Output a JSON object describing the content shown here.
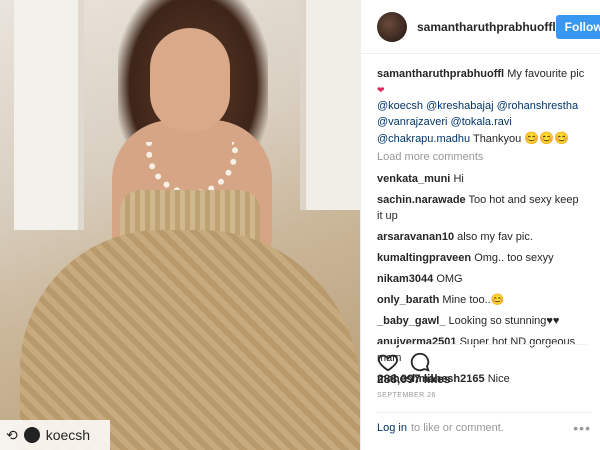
{
  "post": {
    "username": "samantharuthprabhuoffl",
    "follow_label": "Follow",
    "caption_text": "My favourite pic",
    "caption_heart": "❤",
    "mentions_line1": [
      "@koecsh",
      "@kreshabajaj",
      "@rohanshrestha"
    ],
    "mentions_line2": [
      "@vanrajzaveri",
      "@tokala.ravi"
    ],
    "mentions_line3": [
      "@chakrapu.madhu"
    ],
    "thanks_text": "Thankyou",
    "thanks_emoji": "😊😊😊",
    "load_more": "Load more comments",
    "comments": [
      {
        "user": "venkata_muni",
        "text": "Hi"
      },
      {
        "user": "sachin.narawade",
        "text": "Too hot and sexy keep it up"
      },
      {
        "user": "arsaravanan10",
        "text": "also my fav pic."
      },
      {
        "user": "kumaltingpraveen",
        "text": "Omg.. too sexyy"
      },
      {
        "user": "nikam3044",
        "text": "OMG"
      },
      {
        "user": "only_barath",
        "text": "Mine too..😊"
      },
      {
        "user": "_baby_gawl_",
        "text": "Looking so stunning♥♥"
      },
      {
        "user": "anujverma2501",
        "text": "Super hot ND gorgeous mam"
      },
      {
        "user": "maheshmahesh2165",
        "text": "Nice"
      }
    ],
    "likes": "288,097 likes",
    "date": "SEPTEMBER 26",
    "login_link": "Log in",
    "login_rest": "to like or comment.",
    "more_options": "•••"
  },
  "repost": {
    "icon": "repost-icon",
    "account": "koecsh"
  }
}
